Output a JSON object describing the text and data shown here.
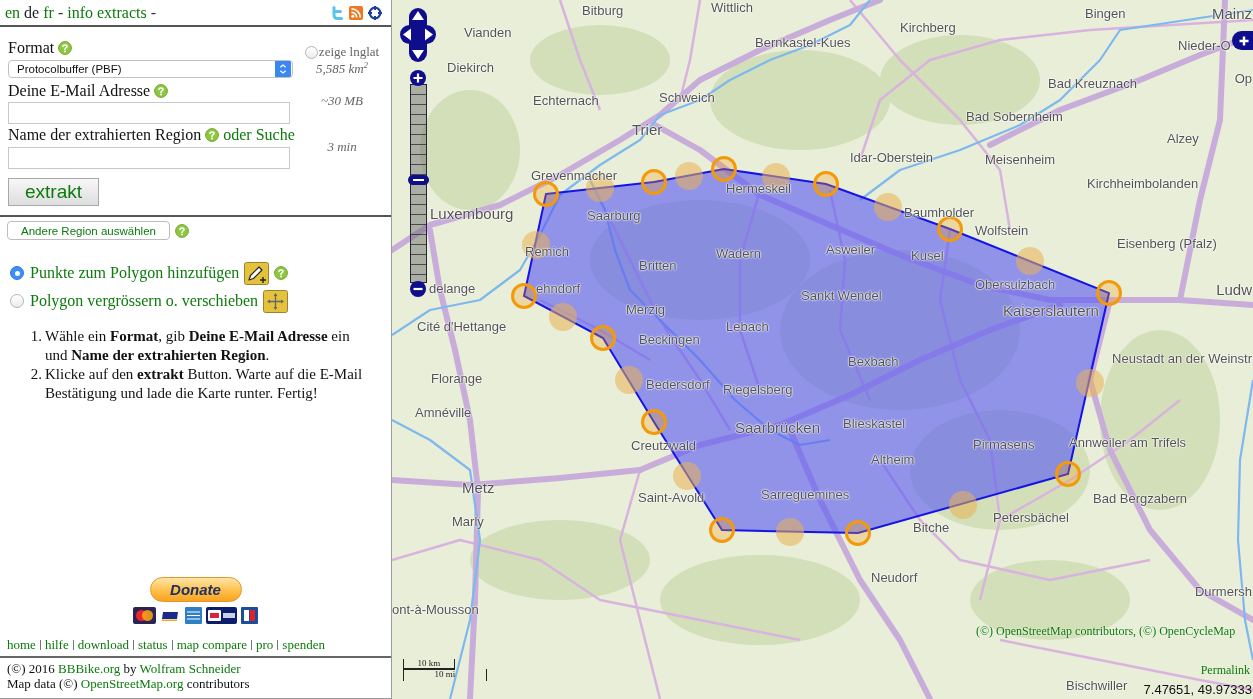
{
  "header": {
    "languages": [
      {
        "label": "en",
        "selected": false
      },
      {
        "label": "de",
        "selected": true
      },
      {
        "label": "fr",
        "selected": false
      }
    ],
    "links": [
      "info",
      "extracts"
    ],
    "separators": [
      "-",
      "-"
    ]
  },
  "form": {
    "format": {
      "label": "Format",
      "value": "Protocolbuffer (PBF)"
    },
    "email": {
      "label": "Deine E-Mail Adresse"
    },
    "region": {
      "label": "Name der extrahierten Region",
      "search_link": "oder Suche"
    },
    "submit": "extrakt"
  },
  "stats": {
    "lnglat": {
      "label": "zeige lnglat",
      "checked": false
    },
    "area": "5,585 km$^{2}$",
    "size": "~30 MB",
    "time": "3 min"
  },
  "region_button": "Andere Region auswählen",
  "modes": [
    {
      "kind": "add",
      "label": "Punkte zum Polygon hinzufügen",
      "selected": true,
      "help": true
    },
    {
      "kind": "move",
      "label": "Polygon vergrössern o. verschieben",
      "selected": false,
      "help": false
    }
  ],
  "instructions": [
    {
      "number": "1.",
      "text": "Wähle ein **Format**, gib **Deine E-Mail Adresse** ein und **Name der extrahierten Region**."
    },
    {
      "number": "2.",
      "text": "Klicke auf den **extrakt** Button. Warte auf die E-Mail Bestätigung und lade die Karte runter. Fertig!"
    }
  ],
  "donate": {
    "label": "Donate"
  },
  "footer_links": [
    "home",
    "hilfe",
    "download",
    "status",
    "map compare",
    "pro",
    "spenden"
  ],
  "credits": [
    [
      {
        "text": "(©) 2016",
        "link": false
      },
      {
        "text": "BBBike.org",
        "link": true
      },
      {
        "text": "by",
        "link": false
      },
      {
        "text": "Wolfram Schneider",
        "link": true
      }
    ],
    [
      {
        "text": "Map data (©)",
        "link": false
      },
      {
        "text": "OpenStreetMap.org",
        "link": true
      },
      {
        "text": "contributors",
        "link": false
      }
    ]
  ],
  "map": {
    "labels": [
      {
        "text": "Bitburg",
        "kind": "town"
      },
      {
        "text": "Wittlich",
        "kind": "town"
      },
      {
        "text": "Bingen",
        "kind": "town"
      },
      {
        "text": "Mainz",
        "kind": "city"
      },
      {
        "text": "Vianden",
        "kind": "town"
      },
      {
        "text": "Kirchberg",
        "kind": "town"
      },
      {
        "text": "Bernkastel-Kues",
        "kind": "town"
      },
      {
        "text": "Nieder-O",
        "kind": "town"
      },
      {
        "text": "Diekirch",
        "kind": "town"
      },
      {
        "text": "Op",
        "kind": "town"
      },
      {
        "text": "Bad Kreuznach",
        "kind": "town"
      },
      {
        "text": "Echternach",
        "kind": "town"
      },
      {
        "text": "Schweich",
        "kind": "town"
      },
      {
        "text": "Bad Sobernheim",
        "kind": "town"
      },
      {
        "text": "Trier",
        "kind": "city"
      },
      {
        "text": "Alzey",
        "kind": "town"
      },
      {
        "text": "Idar-Oberstein",
        "kind": "town"
      },
      {
        "text": "Meisenheim",
        "kind": "town"
      },
      {
        "text": "Grevenmacher",
        "kind": "town"
      },
      {
        "text": "Hermeskeil",
        "kind": "town"
      },
      {
        "text": "Kirchheimbolanden",
        "kind": "town"
      },
      {
        "text": "Luxembourg",
        "kind": "city"
      },
      {
        "text": "Saarburg",
        "kind": "town"
      },
      {
        "text": "Baumholder",
        "kind": "town"
      },
      {
        "text": "Wolfstein",
        "kind": "town"
      },
      {
        "text": "Eisenberg (Pfalz)",
        "kind": "town"
      },
      {
        "text": "Remich",
        "kind": "town"
      },
      {
        "text": "Wadern",
        "kind": "town"
      },
      {
        "text": "Asweiler",
        "kind": "town"
      },
      {
        "text": "Kusel",
        "kind": "town"
      },
      {
        "text": "Britten",
        "kind": "town"
      },
      {
        "text": "Obersulzbach",
        "kind": "town"
      },
      {
        "text": "delange",
        "kind": "town"
      },
      {
        "text": "ehndorf",
        "kind": "town"
      },
      {
        "text": "Ludw",
        "kind": "city"
      },
      {
        "text": "Sankt Wendel",
        "kind": "town"
      },
      {
        "text": "Merzig",
        "kind": "town"
      },
      {
        "text": "Kaiserslautern",
        "kind": "city"
      },
      {
        "text": "Cité d'Hettange",
        "kind": "town"
      },
      {
        "text": "Lebach",
        "kind": "town"
      },
      {
        "text": "Beckingen",
        "kind": "town"
      },
      {
        "text": "Bexbach",
        "kind": "town"
      },
      {
        "text": "Neustadt an der Weinstr",
        "kind": "town"
      },
      {
        "text": "Florange",
        "kind": "town"
      },
      {
        "text": "Bedersdorf",
        "kind": "town"
      },
      {
        "text": "Riegelsberg",
        "kind": "town"
      },
      {
        "text": "Amnéville",
        "kind": "town"
      },
      {
        "text": "Saarbrücken",
        "kind": "city"
      },
      {
        "text": "Blieskastel",
        "kind": "town"
      },
      {
        "text": "Creutzwald",
        "kind": "town"
      },
      {
        "text": "Pirmasens",
        "kind": "town"
      },
      {
        "text": "Annweiler am Trifels",
        "kind": "town"
      },
      {
        "text": "Altheim",
        "kind": "town"
      },
      {
        "text": "Metz",
        "kind": "city"
      },
      {
        "text": "Saint-Avold",
        "kind": "town"
      },
      {
        "text": "Sarreguemines",
        "kind": "town"
      },
      {
        "text": "Bad Bergzabern",
        "kind": "town"
      },
      {
        "text": "Marly",
        "kind": "town"
      },
      {
        "text": "Bitche",
        "kind": "town"
      },
      {
        "text": "Petersbächel",
        "kind": "town"
      },
      {
        "text": "Neudorf",
        "kind": "town"
      },
      {
        "text": "Durmersh",
        "kind": "town"
      },
      {
        "text": "ont-à-Mousson",
        "kind": "town"
      },
      {
        "text": "Bischwiller",
        "kind": "town"
      }
    ],
    "zoom_slider": {
      "level": 0.52
    },
    "attribution": "(©) OpenStreetMap contributors, (©) OpenCycleMap",
    "permalink": "Permalink",
    "coordinates": "7.47651, 49.97333",
    "scale": {
      "metric": "10 km",
      "imperial": "10 mi"
    }
  }
}
